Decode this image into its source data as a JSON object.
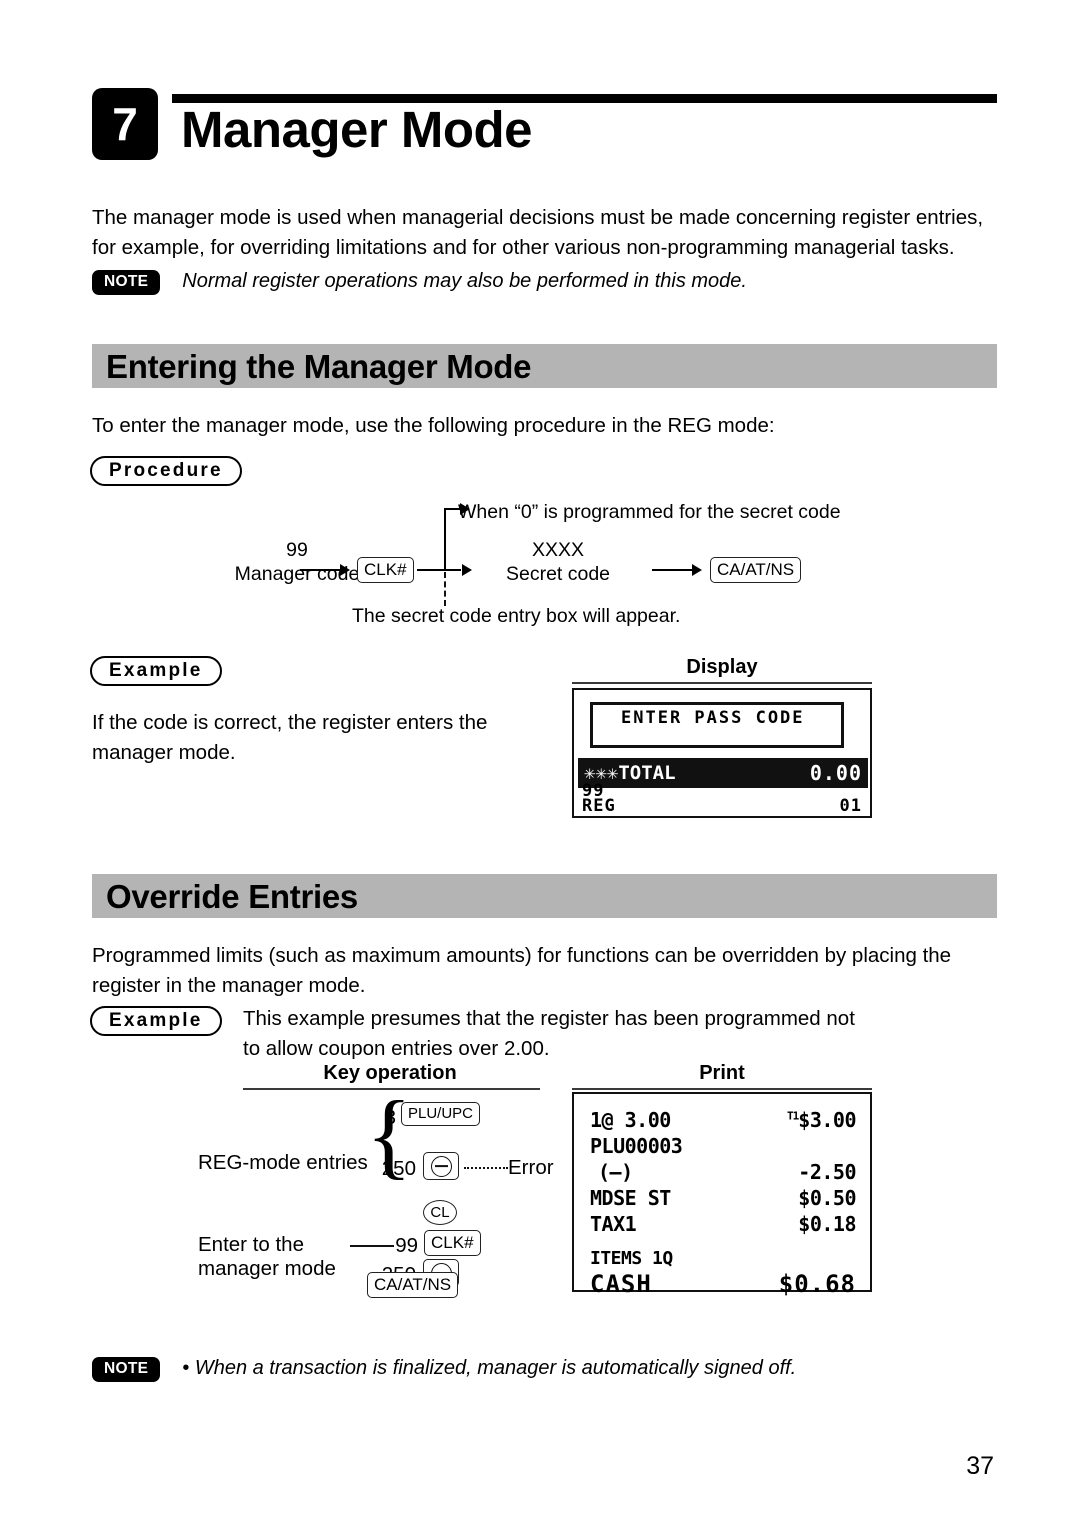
{
  "chapter": {
    "number": "7",
    "title": "Manager Mode"
  },
  "intro_paragraph": "The manager mode is used when managerial decisions must be made concerning register entries, for example, for overriding limitations and for other various non-programming managerial tasks.",
  "note_top": {
    "badge": "NOTE",
    "text": "Normal register operations may also be performed in this mode."
  },
  "note_bottom": {
    "badge": "NOTE",
    "text": "• When a transaction is finalized, manager is automatically signed off."
  },
  "sections": {
    "entering": {
      "heading": "Entering the Manager Mode",
      "lead_in": "To enter the manager mode, use the following procedure in the REG mode:",
      "procedure_pill": "Procedure",
      "procedure": {
        "branch_note": "When “0” is programmed for the secret code",
        "step1_value": "99",
        "step1_label": "Manager code",
        "step2_key": "CLK#",
        "step3_value": "XXXX",
        "step3_label": "Secret code",
        "step4_key": "CA/AT/NS",
        "footnote": "The secret code entry box will appear."
      },
      "example_pill": "Example",
      "example_text": "If the code is correct, the register enters the manager mode.",
      "display_caption": "Display",
      "display": {
        "pass_code_label": "ENTER PASS CODE",
        "total_label": "✳✳✳TOTAL",
        "total_amount": "0.00",
        "clerk_code": "99",
        "mode": "REG",
        "register_no": "01"
      }
    },
    "override": {
      "heading": "Override Entries",
      "body": "Programmed limits (such as maximum amounts) for functions can be overridden by placing the register in the manager mode.",
      "example_pill": "Example",
      "example_text": "This example presumes that the register has been programmed not to allow coupon entries over 2.00.",
      "key_operation_caption": "Key operation",
      "key_operation": {
        "group_label": "REG-mode entries",
        "row1_value": "3",
        "row1_key": "PLU/UPC",
        "row2_value": "250",
        "row2_key": "minus-key",
        "row2_annotation": "Error",
        "row3_key": "CL",
        "enter_label_line1": "Enter to the",
        "enter_label_line2": "manager mode",
        "row4_value": "99",
        "row4_key": "CLK#",
        "row5_value": "250",
        "row5_key": "minus-key",
        "row6_key": "CA/AT/NS"
      },
      "print_caption": "Print",
      "receipt": {
        "lines": [
          {
            "left": "1@ 3.00",
            "right": "$3.00",
            "tax_prefix": "T1",
            "big": false
          },
          {
            "left": "PLU00003",
            "right": "",
            "tax_prefix": "",
            "big": false
          },
          {
            "left": "(—)",
            "right": "-2.50",
            "tax_prefix": "",
            "big": false
          },
          {
            "left": "MDSE ST",
            "right": "$0.50",
            "tax_prefix": "",
            "big": false
          },
          {
            "left": "TAX1",
            "right": "$0.18",
            "tax_prefix": "",
            "big": false
          },
          {
            "left": "ITEMS 1Q",
            "right": "",
            "tax_prefix": "",
            "big": false
          },
          {
            "left": "CASH",
            "right": "$0.68",
            "tax_prefix": "",
            "big": true
          }
        ]
      }
    }
  },
  "page_number": "37",
  "colors": {
    "section_bar_gray": "#b4b4b4",
    "ink": "#000000",
    "paper": "#ffffff"
  }
}
